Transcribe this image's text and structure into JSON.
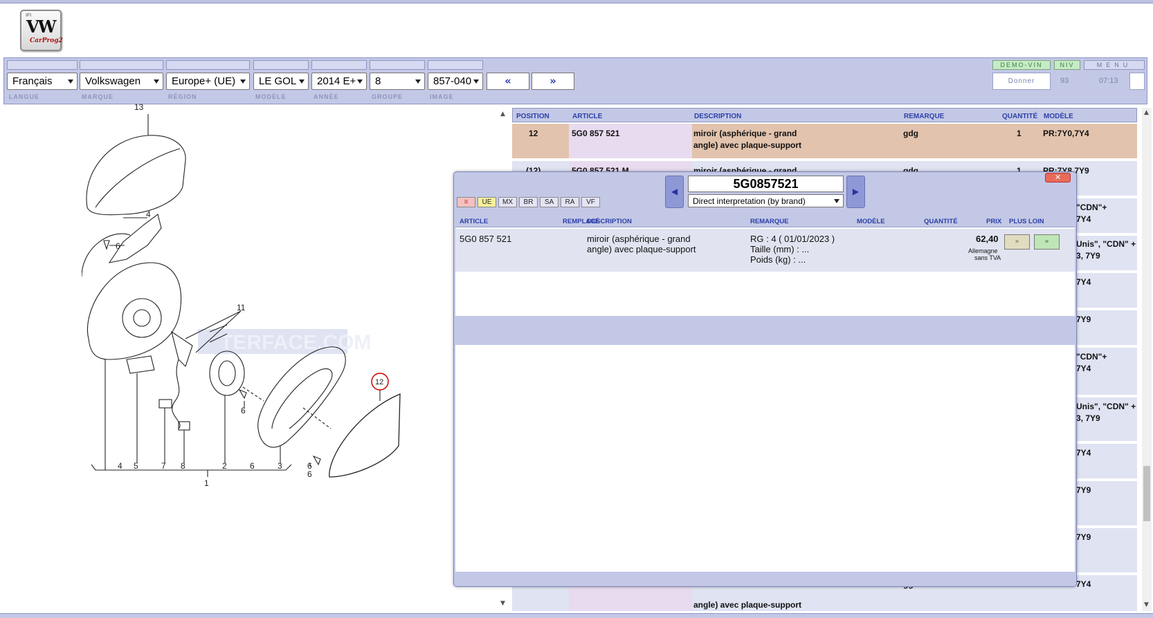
{
  "logo": {
    "top": "IFI",
    "brand": "VW",
    "product": "CarProg2"
  },
  "header": {
    "buttons": {
      "demo_vin": "DEMO-VIN",
      "niv": "NIV",
      "menu": "MENU"
    },
    "selects": {
      "language": "Français",
      "brand": "Volkswagen",
      "region": "Europe+ (UE)",
      "model": "LE GOL",
      "year": "2014 E+",
      "group": "8",
      "image": "857-040"
    },
    "nav": {
      "prev": "«",
      "next": "»"
    },
    "donner": "Donner",
    "count": "93",
    "time": "07:13",
    "labels": {
      "language": "LANGUE",
      "brand": "MARQUE",
      "region": "RÉGION",
      "model": "MODÈLE",
      "year": "ANNÉE",
      "group": "GROUPE",
      "image": "IMAGE"
    }
  },
  "diagram": {
    "callouts": [
      "13",
      "4",
      "6",
      "11",
      "12",
      "6",
      "6",
      "4",
      "5",
      "7",
      "8",
      "2",
      "6",
      "3",
      "6",
      "1"
    ],
    "watermark": "TERFACE.COM"
  },
  "parts_table": {
    "columns": {
      "position": "POSITION",
      "article": "ARTICLE",
      "description": "DESCRIPTION",
      "remark": "REMARQUE",
      "quantity": "QUANTITÉ",
      "model": "MODÈLE"
    },
    "rows": [
      {
        "position": "12",
        "article": "5G0 857 521",
        "description_1": "miroir (asphérique - grand",
        "description_2": "angle) avec plaque-support",
        "remark": "gdg",
        "quantity": "1",
        "model": "PR:7Y0,7Y4"
      },
      {
        "position": "(12)",
        "article": "5G0 857 521 M",
        "description_1": "miroir (asphérique - grand",
        "remark": "gdg",
        "quantity": "1",
        "model_1": "PR:7Y8,7Y9"
      }
    ],
    "fragments": [
      {
        "line1": "\"CDN\"+",
        "line2": "7Y4"
      },
      {
        "line1": "Unis\", \"CDN\" +",
        "line2": "3, 7Y9"
      },
      {
        "line1": "7Y4",
        "line2": ""
      },
      {
        "line1": "7Y9",
        "line2": ""
      },
      {
        "line1": "\"CDN\"+",
        "line2": "7Y4"
      },
      {
        "line1": "Unis\", \"CDN\" +",
        "line2": "3, 7Y9"
      },
      {
        "line1": "7Y4",
        "line2": ""
      },
      {
        "line1": "7Y9",
        "line2": ""
      },
      {
        "line1": "7Y9",
        "line2": ""
      },
      {
        "line1": "7Y4",
        "line2": ""
      }
    ],
    "last_desc": "angle) avec plaque-support",
    "last_remark": "gg"
  },
  "popup": {
    "close": "✕",
    "part_number": "5G0857521",
    "interpretation": "Direct interpretation (by brand)",
    "markets": [
      "≡",
      "UE",
      "MX",
      "BR",
      "SA",
      "RA",
      "VF"
    ],
    "columns": {
      "article": "ARTICLE",
      "replaced": "REMPLACÉ",
      "description": "DESCRIPTION",
      "remark": "REMARQUE",
      "model": "MODÈLE",
      "quantity": "QUANTITÉ",
      "price": "PRIX",
      "more": "PLUS LOIN"
    },
    "row": {
      "article": "5G0 857 521",
      "description_1": "miroir (asphérique - grand",
      "description_2": "angle) avec plaque-support",
      "remark_1": "RG : 4 ( 01/01/2023 )",
      "remark_2": "Taille (mm) : ...",
      "remark_3": "Poids (kg) : ...",
      "price": "62,40",
      "price_note_1": "Allemagne",
      "price_note_2": "sans TVA",
      "btn1": "»",
      "btn2": "»"
    }
  },
  "colors": {
    "panel": "#c3c8e6",
    "header_text": "#2b3fa8",
    "highlight_row": "#e2c3ad",
    "article_cell": "#e8dbef"
  }
}
